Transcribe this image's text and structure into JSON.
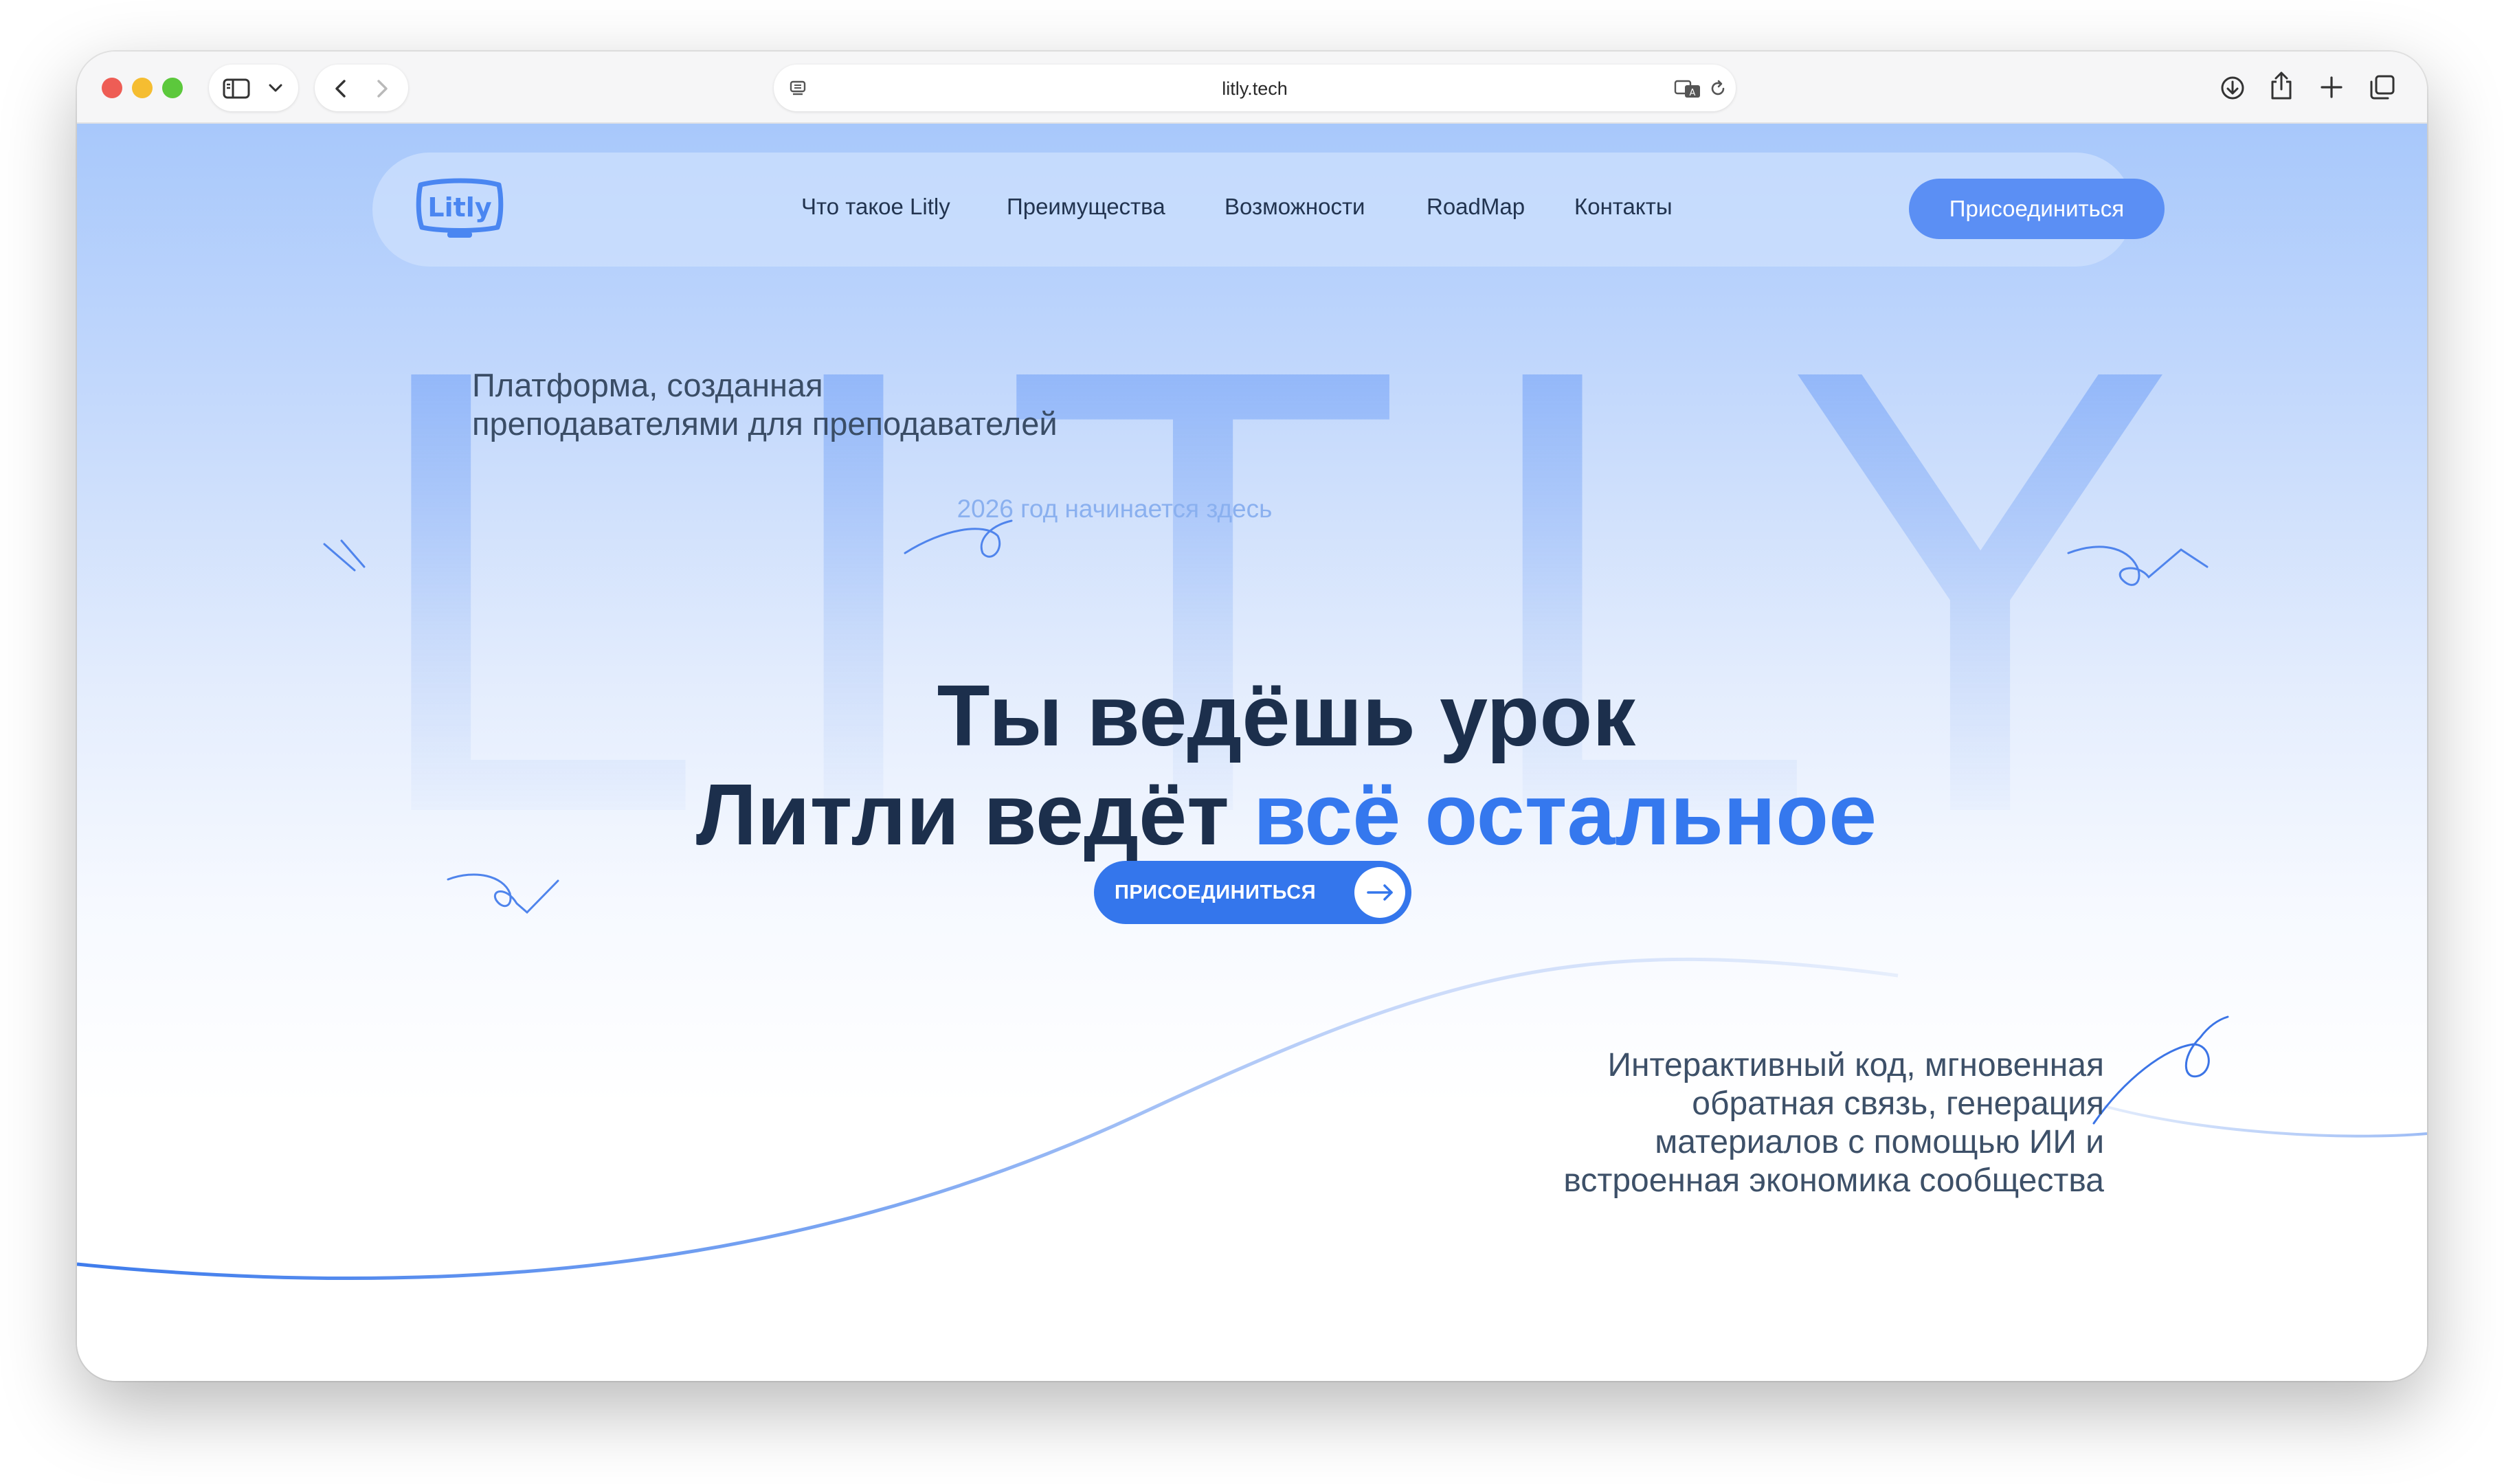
{
  "browser": {
    "url": "litly.tech",
    "traffic_lights": {
      "close": "#ee5d55",
      "minimize": "#f5bd31",
      "maximize": "#5cc83c"
    },
    "icons": [
      "sidebar-icon",
      "chevron-down-icon",
      "back-icon",
      "forward-icon",
      "reader-icon",
      "translate-icon",
      "reload-icon",
      "download-icon",
      "share-icon",
      "new-tab-icon",
      "tabs-overview-icon"
    ]
  },
  "site": {
    "logo_text": "Litly",
    "nav": {
      "links": [
        "Что такое Litly",
        "Преимущества",
        "Возможности",
        "RoadMap",
        "Контакты"
      ],
      "join_label": "Присоединиться"
    },
    "background_word": "LITLY",
    "tagline": {
      "line1": "Платформа, созданная",
      "line2": "преподавателями для преподавателей"
    },
    "year_line": "2026 год начинается здесь",
    "headline": {
      "line1": "Ты ведёшь урок",
      "line2_start": "Литли ведёт ",
      "line2_accent": "всё остальное"
    },
    "cta_label": "ПРИСОЕДИНИТЬСЯ",
    "description": {
      "line1": "Интерактивный код, мгновенная",
      "line2": "обратная связь, генерация",
      "line3": "материалов с помощью ИИ и",
      "line4": "встроенная экономика сообщества"
    },
    "colors": {
      "brand_blue": "#3476ec",
      "nav_button": "#5b8ff4",
      "heading": "#1c2f4c",
      "accent_text": "#3578ee"
    }
  }
}
